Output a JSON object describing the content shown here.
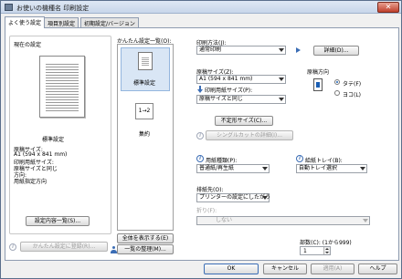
{
  "window": {
    "title": "お使いの機種名 印刷設定",
    "close_glyph": "✕"
  },
  "tabs": [
    {
      "label": "よく使う設定"
    },
    {
      "label": "項目別設定"
    },
    {
      "label": "初期設定/バージョン"
    }
  ],
  "current_settings": {
    "title": "現在の設定",
    "name": "標準設定",
    "details": [
      "原稿サイズ:",
      " A1 (594 x 841 mm)",
      "印刷用紙サイズ:",
      " 原稿サイズと同じ",
      "方向:",
      " 用紙指定方向"
    ],
    "detail_button": "設定内容一覧(S)...",
    "register_button": "かんたん設定に登録(R)..."
  },
  "easy_settings": {
    "title": "かんたん設定一覧(O):",
    "items": [
      {
        "label": "標準設定",
        "icon": "page-icon"
      },
      {
        "label": "集約",
        "icon": "2up-icon",
        "icon_text": "1→2"
      }
    ],
    "show_all_button": "全体を表示する(E)",
    "organize_button": "一覧の整理(M)..."
  },
  "print_method": {
    "label": "印刷方法(J):",
    "value": "通常印刷",
    "detail_button": "詳細(D)..."
  },
  "paper_size": {
    "label": "原稿サイズ(Z):",
    "value": "A1 (594 x 841 mm)",
    "print_label": "印刷用紙サイズ(P):",
    "print_value": "原稿サイズと同じ",
    "custom_button": "不定形サイズ(C)...",
    "shortcut_button": "シングルカットの詳細(I)..."
  },
  "orientation": {
    "label": "原稿方向",
    "options": [
      {
        "label": "タテ(F)",
        "selected": true
      },
      {
        "label": "ヨコ(L)",
        "selected": false
      }
    ]
  },
  "paper_type": {
    "label": "用紙種類(P):",
    "value": "普通紙/再生紙"
  },
  "paper_tray": {
    "label": "給紙トレイ(B):",
    "value": "自動トレイ選択"
  },
  "output": {
    "label": "排紙先(O):",
    "value": "プリンターの設定にしたがう"
  },
  "fold": {
    "label": "折り(F):",
    "value": "しない"
  },
  "copies": {
    "label": "部数(C):  (1から999)",
    "value": "1"
  },
  "footer": {
    "ok": "OK",
    "cancel": "キャンセル",
    "apply": "適用(A)",
    "help": "ヘルプ"
  },
  "colors": {
    "accent": "#3b6db5",
    "title_bg": "#c7d6ea"
  }
}
